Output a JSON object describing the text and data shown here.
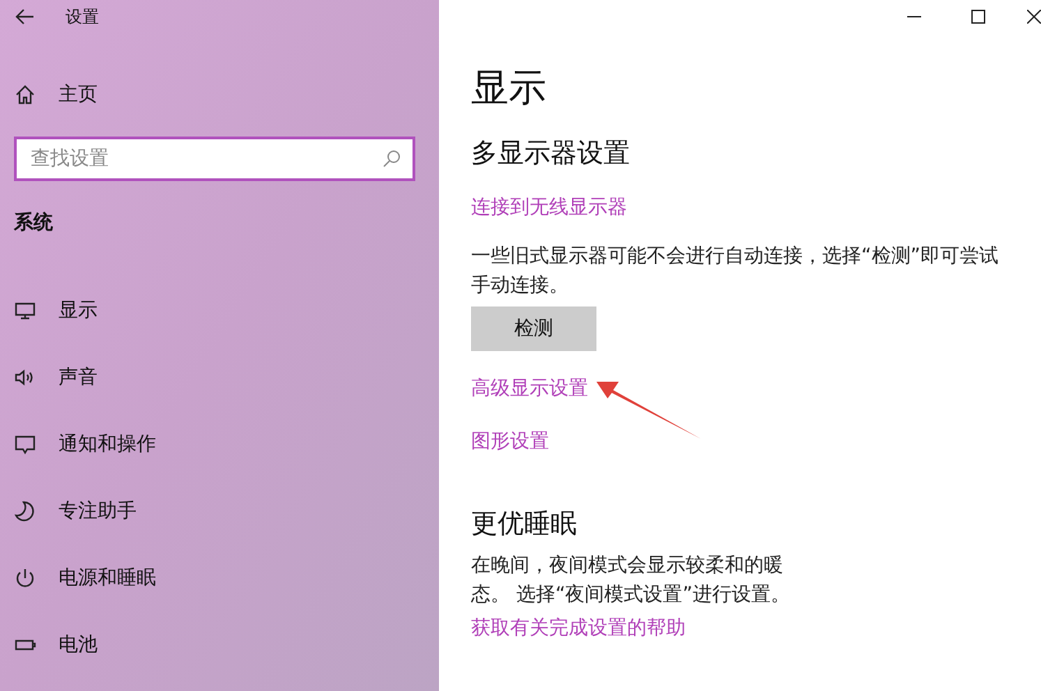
{
  "window": {
    "title": "设置"
  },
  "sidebar": {
    "home": {
      "label": "主页"
    },
    "search": {
      "placeholder": "查找设置"
    },
    "section": "系统",
    "items": [
      {
        "label": "显示",
        "selected": false
      },
      {
        "label": "声音",
        "selected": false
      },
      {
        "label": "通知和操作",
        "selected": false
      },
      {
        "label": "专注助手",
        "selected": false
      },
      {
        "label": "电源和睡眠",
        "selected": false
      },
      {
        "label": "电池",
        "selected": false
      }
    ]
  },
  "page": {
    "title": "显示",
    "sections": [
      {
        "heading": "多显示器设置",
        "blocks": [
          {
            "kind": "link",
            "text": "连接到无线显示器"
          },
          {
            "kind": "text",
            "text": "一些旧式显示器可能不会进行自动连接，选择“检测”即可尝试手动连接。"
          },
          {
            "kind": "button",
            "text": "检测"
          },
          {
            "kind": "link",
            "text": "高级显示设置",
            "annotated": true
          },
          {
            "kind": "link",
            "text": "图形设置"
          }
        ]
      },
      {
        "heading": "更优睡眠",
        "blocks": [
          {
            "kind": "text",
            "text": "在晚间，夜间模式会显示较柔和的暖"
          },
          {
            "kind": "text",
            "text": "态。 选择“夜间模式设置”进行设置。"
          },
          {
            "kind": "link",
            "text": "获取有关完成设置的帮助"
          }
        ]
      }
    ]
  }
}
